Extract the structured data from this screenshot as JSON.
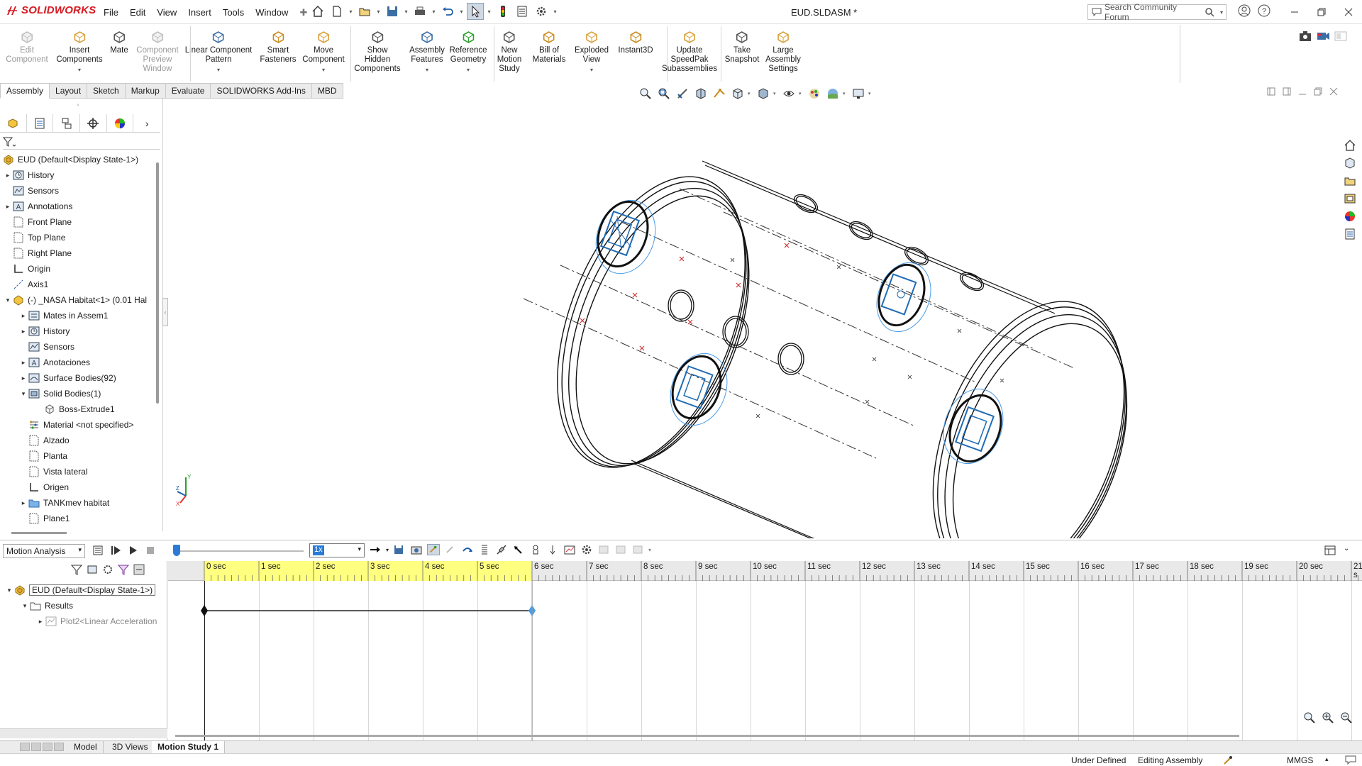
{
  "app": {
    "name": "SOLIDWORKS",
    "document_title": "EUD.SLDASM *"
  },
  "menu": [
    "File",
    "Edit",
    "View",
    "Insert",
    "Tools",
    "Window"
  ],
  "search": {
    "placeholder": "Search Community Forum"
  },
  "command_manager": {
    "commands": [
      {
        "id": "edit-component",
        "label": "Edit\nComponent",
        "enabled": false
      },
      {
        "id": "insert-components",
        "label": "Insert\nComponents",
        "enabled": true,
        "dropdown": true
      },
      {
        "id": "mate",
        "label": "Mate",
        "enabled": true
      },
      {
        "id": "component-preview-window",
        "label": "Component\nPreview\nWindow",
        "enabled": false
      },
      {
        "id": "linear-component-pattern",
        "label": "Linear Component\nPattern",
        "enabled": true,
        "dropdown": true
      },
      {
        "id": "smart-fasteners",
        "label": "Smart\nFasteners",
        "enabled": true
      },
      {
        "id": "move-component",
        "label": "Move\nComponent",
        "enabled": true,
        "dropdown": true
      },
      {
        "id": "show-hidden-components",
        "label": "Show\nHidden\nComponents",
        "enabled": true
      },
      {
        "id": "assembly-features",
        "label": "Assembly\nFeatures",
        "enabled": true,
        "dropdown": true
      },
      {
        "id": "reference-geometry",
        "label": "Reference\nGeometry",
        "enabled": true,
        "dropdown": true
      },
      {
        "id": "new-motion-study",
        "label": "New\nMotion\nStudy",
        "enabled": true
      },
      {
        "id": "bill-of-materials",
        "label": "Bill of\nMaterials",
        "enabled": true
      },
      {
        "id": "exploded-view",
        "label": "Exploded\nView",
        "enabled": true,
        "dropdown": true
      },
      {
        "id": "instant3d",
        "label": "Instant3D",
        "enabled": true
      },
      {
        "id": "update-speedpak",
        "label": "Update\nSpeedPak\nSubassemblies",
        "enabled": true
      },
      {
        "id": "take-snapshot",
        "label": "Take\nSnapshot",
        "enabled": true
      },
      {
        "id": "large-assembly-settings",
        "label": "Large\nAssembly\nSettings",
        "enabled": true
      }
    ],
    "tabs": [
      "Assembly",
      "Layout",
      "Sketch",
      "Markup",
      "Evaluate",
      "SOLIDWORKS Add-Ins",
      "MBD"
    ],
    "active_tab": "Assembly"
  },
  "feature_tree": {
    "root": "EUD  (Default<Display State-1>)",
    "items": [
      {
        "label": "History",
        "icon": "history-icon",
        "expander": "collapsed",
        "level": 1
      },
      {
        "label": "Sensors",
        "icon": "sensors-icon",
        "expander": "none",
        "level": 1
      },
      {
        "label": "Annotations",
        "icon": "annotations-icon",
        "expander": "collapsed",
        "level": 1
      },
      {
        "label": "Front Plane",
        "icon": "plane-icon",
        "expander": "none",
        "level": 1
      },
      {
        "label": "Top Plane",
        "icon": "plane-icon",
        "expander": "none",
        "level": 1
      },
      {
        "label": "Right Plane",
        "icon": "plane-icon",
        "expander": "none",
        "level": 1
      },
      {
        "label": "Origin",
        "icon": "origin-icon",
        "expander": "none",
        "level": 1
      },
      {
        "label": "Axis1",
        "icon": "axis-icon",
        "expander": "none",
        "level": 1
      },
      {
        "label": "(-) _NASA Habitat<1> (0.01 Hal",
        "icon": "part-icon",
        "expander": "expanded",
        "level": 1
      },
      {
        "label": "Mates in Assem1",
        "icon": "mates-icon",
        "expander": "collapsed",
        "level": 2
      },
      {
        "label": "History",
        "icon": "history-icon",
        "expander": "collapsed",
        "level": 2
      },
      {
        "label": "Sensors",
        "icon": "sensors-icon",
        "expander": "none",
        "level": 2
      },
      {
        "label": "Anotaciones",
        "icon": "annotations-icon",
        "expander": "collapsed",
        "level": 2
      },
      {
        "label": "Surface Bodies(92)",
        "icon": "surface-bodies-icon",
        "expander": "collapsed",
        "level": 2
      },
      {
        "label": "Solid Bodies(1)",
        "icon": "solid-bodies-icon",
        "expander": "expanded",
        "level": 2
      },
      {
        "label": "Boss-Extrude1",
        "icon": "body-icon",
        "expander": "none",
        "level": 3
      },
      {
        "label": "Material <not specified>",
        "icon": "material-icon",
        "expander": "none",
        "level": 2
      },
      {
        "label": "Alzado",
        "icon": "plane-icon",
        "expander": "none",
        "level": 2
      },
      {
        "label": "Planta",
        "icon": "plane-icon",
        "expander": "none",
        "level": 2
      },
      {
        "label": "Vista lateral",
        "icon": "plane-icon",
        "expander": "none",
        "level": 2
      },
      {
        "label": "Origen",
        "icon": "origin-icon",
        "expander": "none",
        "level": 2
      },
      {
        "label": "TANKmev habitat",
        "icon": "folder-icon",
        "expander": "collapsed",
        "level": 2
      },
      {
        "label": "Plane1",
        "icon": "plane-icon",
        "expander": "none",
        "level": 2
      }
    ]
  },
  "motion_manager": {
    "study_type": "Motion Analysis",
    "playback_speed": "1x",
    "tree": [
      {
        "label": "EUD  (Default<Display State-1>)",
        "expander": "expanded",
        "level": 0,
        "boxed": true
      },
      {
        "label": "Results",
        "expander": "expanded",
        "level": 1
      },
      {
        "label": "Plot2<Linear Acceleration",
        "expander": "collapsed",
        "level": 2,
        "muted": true
      }
    ],
    "timeline_labels": [
      "0 sec",
      "1 sec",
      "2 sec",
      "3 sec",
      "4 sec",
      "5 sec",
      "6 sec",
      "7 sec",
      "8 sec",
      "9 sec",
      "10 sec",
      "11 sec",
      "12 sec",
      "13 sec",
      "14 sec",
      "15 sec",
      "16 sec",
      "17 sec",
      "18 sec",
      "19 sec",
      "20 sec",
      "21 s"
    ],
    "study_duration_sec": 6,
    "keypoint_times_sec": [
      0,
      6
    ],
    "accent_color": "#ffff80",
    "keypoint_color": "#4a9be8"
  },
  "bottom_tabs": [
    "Model",
    "3D Views",
    "Motion Study 1"
  ],
  "active_bottom_tab": "Motion Study 1",
  "status": {
    "state": "Under Defined",
    "mode": "Editing Assembly",
    "units": "MMGS"
  }
}
